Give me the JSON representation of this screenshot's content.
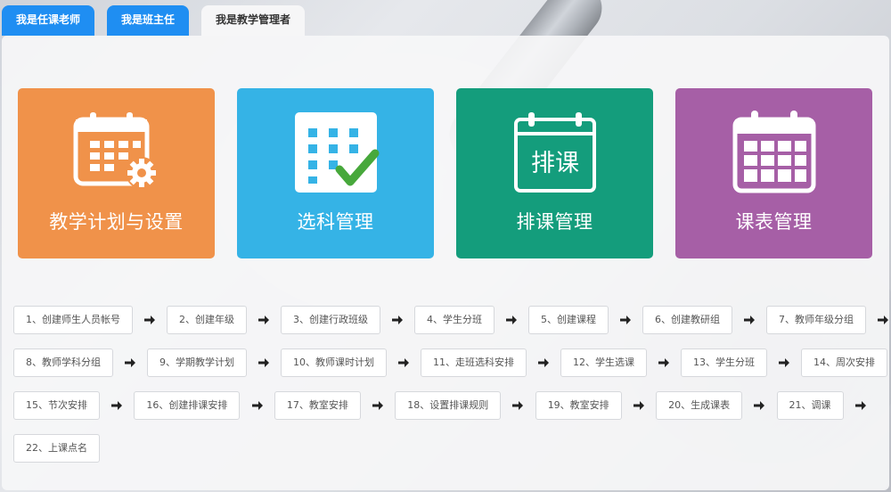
{
  "tabs": [
    {
      "label": "我是任课老师"
    },
    {
      "label": "我是班主任"
    },
    {
      "label": "我是教学管理者"
    }
  ],
  "cards": [
    {
      "label": "教学计划与设置",
      "color": "#f0924a",
      "icon": "calendar-gear-icon"
    },
    {
      "label": "选科管理",
      "color": "#35b3e6",
      "icon": "grid-check-icon"
    },
    {
      "label": "排课管理",
      "color": "#149d7c",
      "icon": "calendar-schedule-icon",
      "icon_text": "排课"
    },
    {
      "label": "课表管理",
      "color": "#a65fa6",
      "icon": "calendar-grid-icon"
    }
  ],
  "steps": [
    "1、创建师生人员帐号",
    "2、创建年级",
    "3、创建行政班级",
    "4、学生分班",
    "5、创建课程",
    "6、创建教研组",
    "7、教师年级分组",
    "8、教师学科分组",
    "9、学期教学计划",
    "10、教师课时计划",
    "11、走班选科安排",
    "12、学生选课",
    "13、学生分班",
    "14、周次安排",
    "15、节次安排",
    "16、创建排课安排",
    "17、教室安排",
    "18、设置排课规则",
    "19、教室安排",
    "20、生成课表",
    "21、调课",
    "22、上课点名"
  ]
}
